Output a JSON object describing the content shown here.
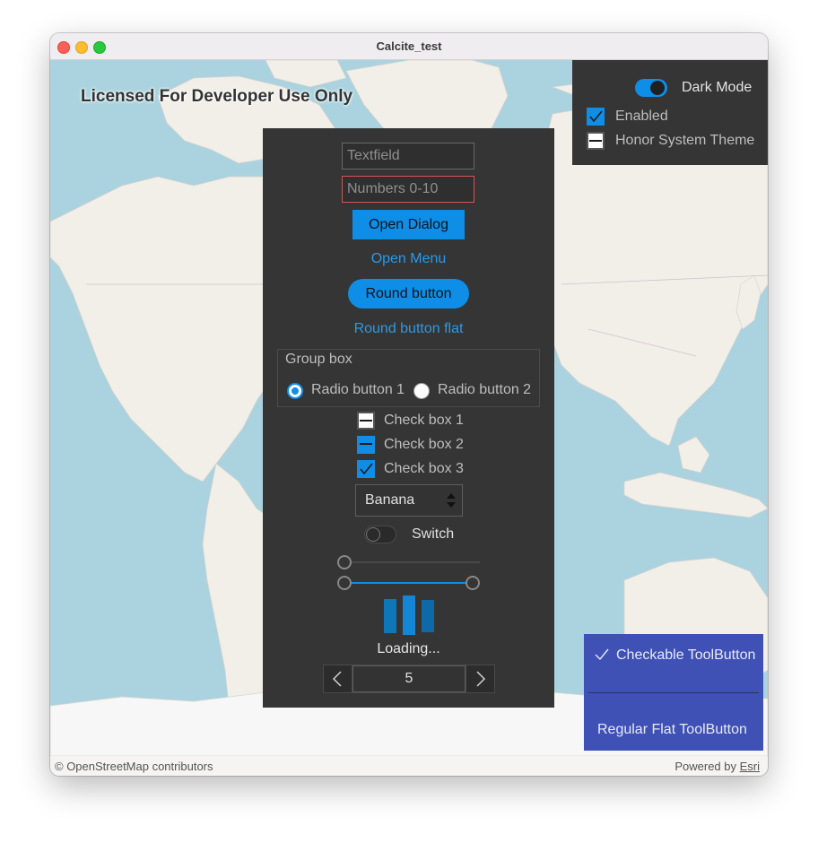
{
  "window": {
    "title": "Calcite_test"
  },
  "map": {
    "license_text": "Licensed For Developer Use Only",
    "attribution_left": "© OpenStreetMap contributors",
    "attribution_powered": "Powered by ",
    "attribution_link": "Esri",
    "colors": {
      "water": "#aad3df",
      "land": "#f2efe9",
      "ice": "#f7f7f7"
    }
  },
  "dark_mode_panel": {
    "switch_label": "Dark Mode",
    "switch_on": true,
    "enabled_label": "Enabled",
    "enabled_checked": true,
    "honor_label": "Honor System Theme",
    "honor_checked": false
  },
  "controls": {
    "textfield_placeholder": "Textfield",
    "numbers_placeholder": "Numbers 0-10",
    "open_dialog": "Open Dialog",
    "open_menu": "Open Menu",
    "round_button": "Round button",
    "round_button_flat": "Round button flat",
    "group_box": {
      "title": "Group box",
      "radio1": "Radio button 1",
      "radio2": "Radio button 2",
      "selected": "Radio button 1"
    },
    "checkboxes": [
      {
        "label": "Check box 1",
        "state": "unchecked"
      },
      {
        "label": "Check box 2",
        "state": "partial"
      },
      {
        "label": "Check box 3",
        "state": "checked"
      }
    ],
    "combo_value": "Banana",
    "switch_label": "Switch",
    "switch_on": false,
    "loading_label": "Loading...",
    "spinbox_value": "5",
    "accent_color": "#0f8ee8"
  },
  "toolbuttons": {
    "checkable": "Checkable ToolButton",
    "checkable_checked": true,
    "regular": "Regular Flat ToolButton",
    "color": "#3f51b5"
  }
}
